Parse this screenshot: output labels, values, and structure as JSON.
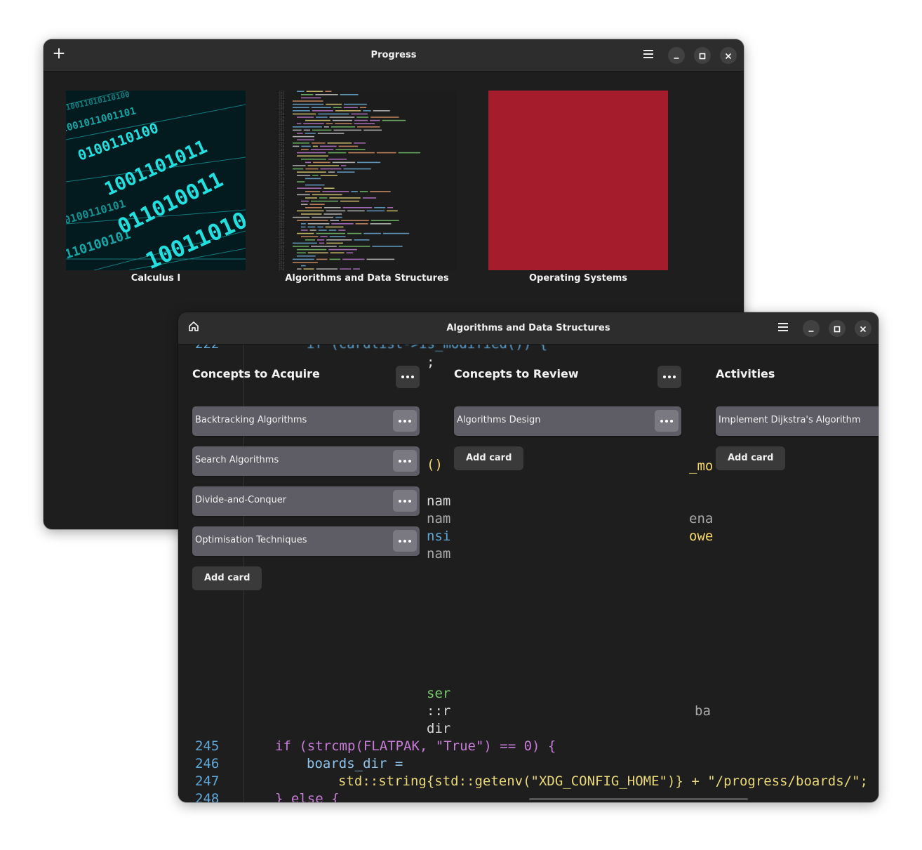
{
  "main_window": {
    "title": "Progress",
    "boards": [
      {
        "name": "Calculus I",
        "background": "binary-tunnel"
      },
      {
        "name": "Algorithms and Data Structures",
        "background": "code-screenshot"
      },
      {
        "name": "Operating Systems",
        "background": "#a51d2d"
      }
    ]
  },
  "board_window": {
    "title": "Algorithms and Data Structures",
    "columns": [
      {
        "title": "Concepts to Acquire",
        "cards": [
          "Backtracking Algorithms",
          "Search Algorithms",
          "Divide-and-Conquer",
          "Optimisation Techniques"
        ],
        "add_label": "Add card"
      },
      {
        "title": "Concepts to Review",
        "cards": [
          "Algorithms Design"
        ],
        "add_label": "Add card"
      },
      {
        "title": "Activities",
        "cards": [
          "Implement Dijkstra's Algorithm"
        ],
        "add_label": "Add card"
      }
    ]
  },
  "code_background": {
    "line_numbers": [
      "222",
      "245",
      "246",
      "247",
      "248"
    ],
    "lines": [
      "if (cardlist->is_modified()) {",
      "if (strcmp(FLATPAK, \"True\") == 0) {",
      "boards_dir =",
      "std::string{std::getenv(\"XDG_CONFIG_HOME\")} + \"/progress/boards/\";",
      "} else {"
    ]
  },
  "colors": {
    "window_bg": "#1e1e1e",
    "headerbar_bg": "#2d2d2d",
    "card_bg": "#5e5c64",
    "button_bg": "#3a3a3a",
    "accent_red": "#a51d2d",
    "binary_cyan": "#19d6d6"
  }
}
